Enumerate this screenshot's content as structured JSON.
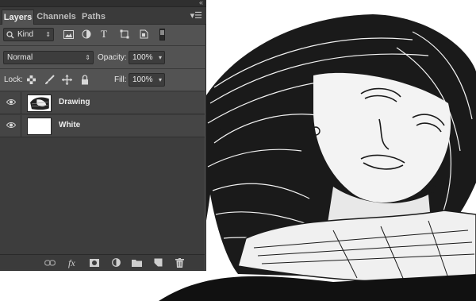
{
  "panel": {
    "tabs": [
      "Layers",
      "Channels",
      "Paths"
    ],
    "active_tab": "Layers"
  },
  "filter": {
    "kind_label": "Kind"
  },
  "blend": {
    "mode": "Normal",
    "opacity_label": "Opacity:",
    "opacity_value": "100%"
  },
  "lock": {
    "label": "Lock:",
    "fill_label": "Fill:",
    "fill_value": "100%"
  },
  "layers": [
    {
      "name": "Drawing",
      "visible": true
    },
    {
      "name": "White",
      "visible": true
    }
  ],
  "bottom_icons": [
    "link-icon",
    "fx-icon",
    "mask-icon",
    "adjustment-icon",
    "folder-icon",
    "new-layer-icon",
    "trash-icon"
  ],
  "fx_glyph": "fx",
  "colors": {
    "panel": "#535353",
    "layers_bg": "#3d3d3d",
    "art_black": "#111111"
  }
}
